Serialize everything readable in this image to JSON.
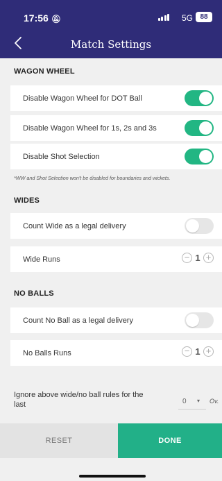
{
  "status": {
    "time": "17:56",
    "silent_icon": "bell-slash-icon",
    "network": "5G",
    "battery": "88"
  },
  "header": {
    "title": "Match Settings",
    "back_icon": "chevron-left-icon",
    "bg": "#2f2c78"
  },
  "colors": {
    "toggle_on": "#22b683",
    "done_bg": "#22b088"
  },
  "sections": {
    "wagon_wheel": {
      "title": "WAGON WHEEL",
      "items": [
        {
          "label": "Disable Wagon Wheel for DOT Ball",
          "enabled": true
        },
        {
          "label": "Disable Wagon Wheel for 1s, 2s and 3s",
          "enabled": true
        },
        {
          "label": "Disable Shot Selection",
          "enabled": true
        }
      ],
      "note": "*WW and Shot Selection won't be disabled for boundaries and wickets."
    },
    "wides": {
      "title": "WIDES",
      "legal_label": "Count Wide as a legal delivery",
      "legal_enabled": false,
      "runs_label": "Wide Runs",
      "runs_value": "1"
    },
    "no_balls": {
      "title": "NO BALLS",
      "legal_label": "Count No Ball as a legal delivery",
      "legal_enabled": false,
      "runs_label": "No Balls Runs",
      "runs_value": "1"
    }
  },
  "ignore": {
    "label": "Ignore above wide/no ball  rules for the last",
    "value": "0",
    "unit": "Ov."
  },
  "stepper": {
    "minus": "−",
    "plus": "+"
  },
  "footer": {
    "reset": "RESET",
    "done": "DONE"
  }
}
